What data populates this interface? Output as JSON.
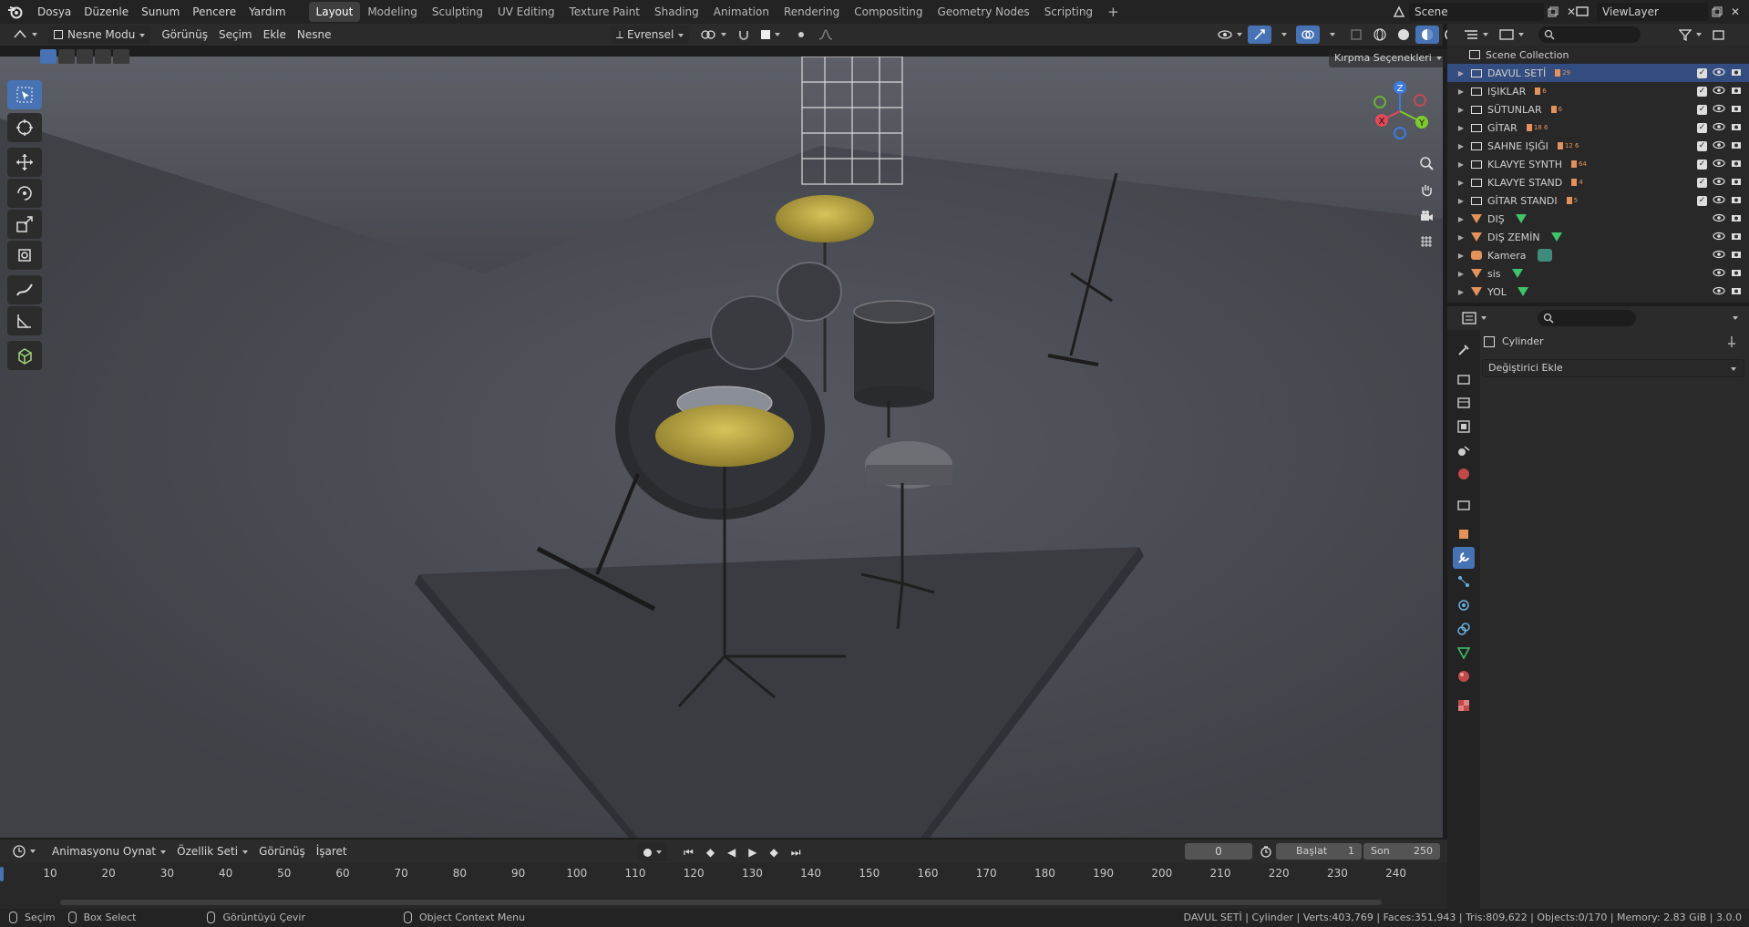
{
  "menus": [
    "Dosya",
    "Düzenle",
    "Sunum",
    "Pencere",
    "Yardım"
  ],
  "workspaces": [
    "Layout",
    "Modeling",
    "Sculpting",
    "UV Editing",
    "Texture Paint",
    "Shading",
    "Animation",
    "Rendering",
    "Compositing",
    "Geometry Nodes",
    "Scripting"
  ],
  "active_workspace": "Layout",
  "add_workspace_label": "+",
  "scene_name": "Scene",
  "view_layer": "ViewLayer",
  "viewport_header": {
    "mode": "Nesne Modu",
    "menus": [
      "Görünüş",
      "Seçim",
      "Ekle",
      "Nesne"
    ],
    "transform_orientation": "Evrensel",
    "clipping_options": "Kırpma Seçenekleri"
  },
  "tools": [
    "select-box",
    "cursor",
    "move",
    "rotate",
    "scale",
    "transform",
    "annotate",
    "measure",
    "add-cube"
  ],
  "outliner": {
    "root": "Scene Collection",
    "rows": [
      {
        "name": "DAVUL SETİ",
        "kind": "collection",
        "badge": "29",
        "checked": true,
        "selected": true
      },
      {
        "name": "IŞIKLAR",
        "kind": "collection",
        "badge": "6",
        "checked": true
      },
      {
        "name": "SÜTUNLAR",
        "kind": "collection",
        "badge": "6",
        "checked": true
      },
      {
        "name": "GİTAR",
        "kind": "collection",
        "badge": "18  6",
        "checked": true
      },
      {
        "name": "SAHNE IŞIĞI",
        "kind": "collection",
        "badge": "12  6",
        "checked": true
      },
      {
        "name": "KLAVYE SYNTH",
        "kind": "collection",
        "badge": "64",
        "checked": true
      },
      {
        "name": "KLAVYE STAND",
        "kind": "collection",
        "badge": "4",
        "checked": true
      },
      {
        "name": "GİTAR STANDI",
        "kind": "collection",
        "badge": "5",
        "checked": true
      },
      {
        "name": "DIŞ",
        "kind": "mesh",
        "badge": ""
      },
      {
        "name": "DIŞ ZEMİN",
        "kind": "mesh",
        "badge": ""
      },
      {
        "name": "Kamera",
        "kind": "camera",
        "badge": ""
      },
      {
        "name": "sis",
        "kind": "mesh",
        "badge": ""
      },
      {
        "name": "YOL",
        "kind": "mesh",
        "badge": ""
      }
    ]
  },
  "properties": {
    "object_name": "Cylinder",
    "add_modifier": "Değiştirici Ekle"
  },
  "timeline": {
    "menus": [
      "Animasyonu Oynat",
      "Özellik Seti",
      "Görünüş",
      "İşaret"
    ],
    "current_frame": "0",
    "start_label": "Başlat",
    "start": "1",
    "end_label": "Son",
    "end": "250",
    "ticks": [
      "10",
      "20",
      "30",
      "40",
      "50",
      "60",
      "70",
      "80",
      "90",
      "100",
      "110",
      "120",
      "130",
      "140",
      "150",
      "160",
      "170",
      "180",
      "190",
      "200",
      "210",
      "220",
      "230",
      "240"
    ]
  },
  "status": {
    "left": [
      "Seçim",
      "Box Select",
      "Görüntüyü Çevir",
      "Object Context Menu"
    ],
    "right": "DAVUL SETİ | Cylinder | Verts:403,769 | Faces:351,943 | Tris:809,622 | Objects:0/170 | Memory: 2.83 GiB | 3.0.0"
  },
  "gizmo_axes": [
    "X",
    "Y",
    "Z"
  ],
  "colors": {
    "accent": "#4772b3",
    "selection": "#334d80",
    "collection_orange": "#e2925a",
    "mesh_green": "#3fc36b"
  }
}
